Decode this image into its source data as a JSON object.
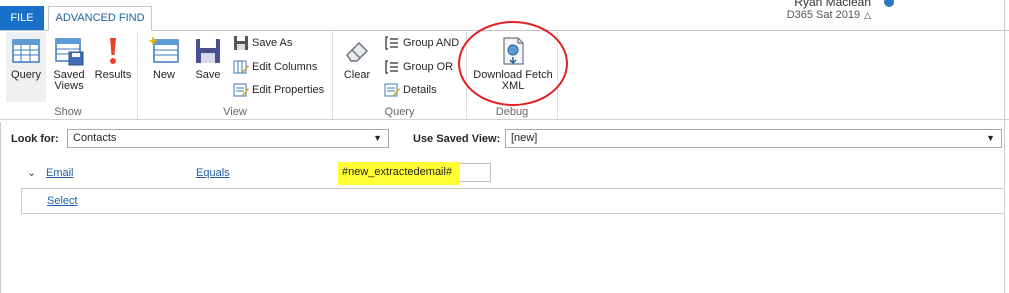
{
  "tabs": {
    "file": "FILE",
    "advanced_find": "ADVANCED FIND"
  },
  "user": {
    "name": "Ryan Maclean",
    "org": "D365 Sat 2019"
  },
  "ribbon": {
    "show_group": {
      "label": "Show",
      "query": "Query",
      "saved_views_line1": "Saved",
      "saved_views_line2": "Views",
      "results": "Results"
    },
    "view_group": {
      "label": "View",
      "new": "New",
      "save": "Save",
      "save_as": "Save As",
      "edit_columns": "Edit Columns",
      "edit_properties": "Edit Properties"
    },
    "query_group": {
      "label": "Query",
      "clear": "Clear",
      "group_and": "Group AND",
      "group_or": "Group OR",
      "details": "Details"
    },
    "debug_group": {
      "label": "Debug",
      "download_fetch_line1": "Download Fetch",
      "download_fetch_line2": "XML"
    }
  },
  "criteria": {
    "look_for_label": "Look for:",
    "look_for_value": "Contacts",
    "saved_view_label": "Use Saved View:",
    "saved_view_value": "[new]"
  },
  "filter": {
    "field": "Email",
    "operator": "Equals",
    "value": "#new_extractedemail#",
    "select_link": "Select"
  },
  "colors": {
    "file_tab": "#1870c8",
    "highlight": "#ffff33",
    "annotation_circle": "#e02020",
    "link": "#1f5fa8"
  }
}
